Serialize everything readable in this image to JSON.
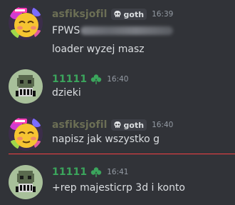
{
  "messages": [
    {
      "username": "asfiksjofil",
      "username_color": "#6c6f55",
      "tag": "goth",
      "time": "16:39",
      "lines": [
        "FPWS",
        "loader wyzej masz"
      ]
    },
    {
      "username": "11111",
      "username_color": "#3ba55c",
      "badge_icon": "clover-icon",
      "time": "16:40",
      "lines": [
        "dzieki"
      ]
    },
    {
      "username": "asfiksjofil",
      "username_color": "#6c6f55",
      "tag": "goth",
      "time": "16:40",
      "lines": [
        "napisz  jak wszystko g"
      ]
    },
    {
      "username": "11111",
      "username_color": "#3ba55c",
      "badge_icon": "clover-icon",
      "time": "16:41",
      "lines": [
        "+rep majesticrp 3d i konto"
      ]
    }
  ],
  "colors": {
    "background": "#313338",
    "text": "#dbdee1",
    "timestamp": "#949ba4",
    "new_messages_divider": "#f23f43"
  }
}
